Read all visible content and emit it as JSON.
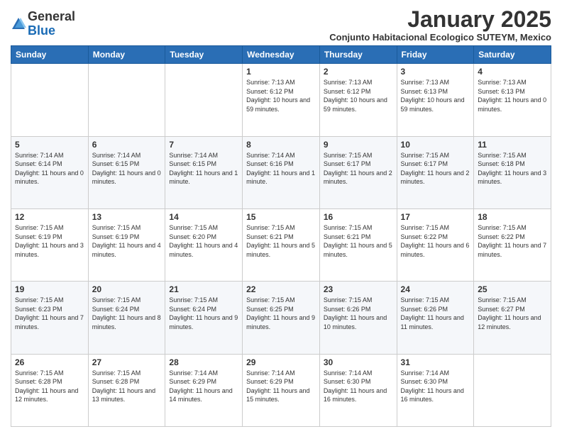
{
  "header": {
    "logo_general": "General",
    "logo_blue": "Blue",
    "month_title": "January 2025",
    "location": "Conjunto Habitacional Ecologico SUTEYM, Mexico"
  },
  "days_of_week": [
    "Sunday",
    "Monday",
    "Tuesday",
    "Wednesday",
    "Thursday",
    "Friday",
    "Saturday"
  ],
  "weeks": [
    [
      {
        "day": "",
        "text": ""
      },
      {
        "day": "",
        "text": ""
      },
      {
        "day": "",
        "text": ""
      },
      {
        "day": "1",
        "text": "Sunrise: 7:13 AM\nSunset: 6:12 PM\nDaylight: 10 hours and 59 minutes."
      },
      {
        "day": "2",
        "text": "Sunrise: 7:13 AM\nSunset: 6:12 PM\nDaylight: 10 hours and 59 minutes."
      },
      {
        "day": "3",
        "text": "Sunrise: 7:13 AM\nSunset: 6:13 PM\nDaylight: 10 hours and 59 minutes."
      },
      {
        "day": "4",
        "text": "Sunrise: 7:13 AM\nSunset: 6:13 PM\nDaylight: 11 hours and 0 minutes."
      }
    ],
    [
      {
        "day": "5",
        "text": "Sunrise: 7:14 AM\nSunset: 6:14 PM\nDaylight: 11 hours and 0 minutes."
      },
      {
        "day": "6",
        "text": "Sunrise: 7:14 AM\nSunset: 6:15 PM\nDaylight: 11 hours and 0 minutes."
      },
      {
        "day": "7",
        "text": "Sunrise: 7:14 AM\nSunset: 6:15 PM\nDaylight: 11 hours and 1 minute."
      },
      {
        "day": "8",
        "text": "Sunrise: 7:14 AM\nSunset: 6:16 PM\nDaylight: 11 hours and 1 minute."
      },
      {
        "day": "9",
        "text": "Sunrise: 7:15 AM\nSunset: 6:17 PM\nDaylight: 11 hours and 2 minutes."
      },
      {
        "day": "10",
        "text": "Sunrise: 7:15 AM\nSunset: 6:17 PM\nDaylight: 11 hours and 2 minutes."
      },
      {
        "day": "11",
        "text": "Sunrise: 7:15 AM\nSunset: 6:18 PM\nDaylight: 11 hours and 3 minutes."
      }
    ],
    [
      {
        "day": "12",
        "text": "Sunrise: 7:15 AM\nSunset: 6:19 PM\nDaylight: 11 hours and 3 minutes."
      },
      {
        "day": "13",
        "text": "Sunrise: 7:15 AM\nSunset: 6:19 PM\nDaylight: 11 hours and 4 minutes."
      },
      {
        "day": "14",
        "text": "Sunrise: 7:15 AM\nSunset: 6:20 PM\nDaylight: 11 hours and 4 minutes."
      },
      {
        "day": "15",
        "text": "Sunrise: 7:15 AM\nSunset: 6:21 PM\nDaylight: 11 hours and 5 minutes."
      },
      {
        "day": "16",
        "text": "Sunrise: 7:15 AM\nSunset: 6:21 PM\nDaylight: 11 hours and 5 minutes."
      },
      {
        "day": "17",
        "text": "Sunrise: 7:15 AM\nSunset: 6:22 PM\nDaylight: 11 hours and 6 minutes."
      },
      {
        "day": "18",
        "text": "Sunrise: 7:15 AM\nSunset: 6:22 PM\nDaylight: 11 hours and 7 minutes."
      }
    ],
    [
      {
        "day": "19",
        "text": "Sunrise: 7:15 AM\nSunset: 6:23 PM\nDaylight: 11 hours and 7 minutes."
      },
      {
        "day": "20",
        "text": "Sunrise: 7:15 AM\nSunset: 6:24 PM\nDaylight: 11 hours and 8 minutes."
      },
      {
        "day": "21",
        "text": "Sunrise: 7:15 AM\nSunset: 6:24 PM\nDaylight: 11 hours and 9 minutes."
      },
      {
        "day": "22",
        "text": "Sunrise: 7:15 AM\nSunset: 6:25 PM\nDaylight: 11 hours and 9 minutes."
      },
      {
        "day": "23",
        "text": "Sunrise: 7:15 AM\nSunset: 6:26 PM\nDaylight: 11 hours and 10 minutes."
      },
      {
        "day": "24",
        "text": "Sunrise: 7:15 AM\nSunset: 6:26 PM\nDaylight: 11 hours and 11 minutes."
      },
      {
        "day": "25",
        "text": "Sunrise: 7:15 AM\nSunset: 6:27 PM\nDaylight: 11 hours and 12 minutes."
      }
    ],
    [
      {
        "day": "26",
        "text": "Sunrise: 7:15 AM\nSunset: 6:28 PM\nDaylight: 11 hours and 12 minutes."
      },
      {
        "day": "27",
        "text": "Sunrise: 7:15 AM\nSunset: 6:28 PM\nDaylight: 11 hours and 13 minutes."
      },
      {
        "day": "28",
        "text": "Sunrise: 7:14 AM\nSunset: 6:29 PM\nDaylight: 11 hours and 14 minutes."
      },
      {
        "day": "29",
        "text": "Sunrise: 7:14 AM\nSunset: 6:29 PM\nDaylight: 11 hours and 15 minutes."
      },
      {
        "day": "30",
        "text": "Sunrise: 7:14 AM\nSunset: 6:30 PM\nDaylight: 11 hours and 16 minutes."
      },
      {
        "day": "31",
        "text": "Sunrise: 7:14 AM\nSunset: 6:30 PM\nDaylight: 11 hours and 16 minutes."
      },
      {
        "day": "",
        "text": ""
      }
    ]
  ]
}
